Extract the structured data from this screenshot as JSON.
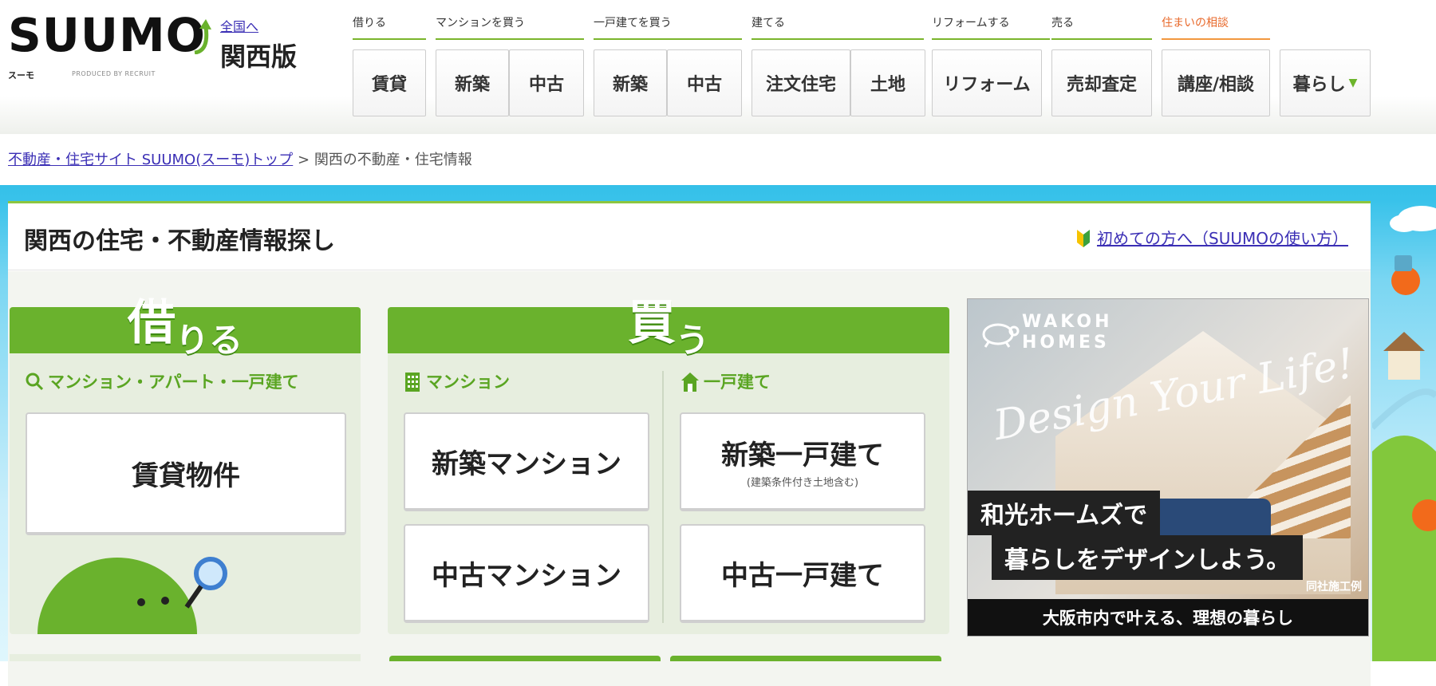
{
  "header": {
    "logo_text": "SUUMO",
    "logo_sub": "スーモ",
    "logo_produced": "PRODUCED BY RECRUIT",
    "region_link": "全国へ",
    "region_name": "関西版",
    "categories": [
      "借りる",
      "マンションを買う",
      "一戸建てを買う",
      "建てる",
      "リフォームする",
      "売る",
      "住まいの相談"
    ],
    "nav": [
      "賃貸",
      "新築",
      "中古",
      "新築",
      "中古",
      "注文住宅",
      "土地",
      "リフォーム",
      "売却査定",
      "講座/相談",
      "暮らし"
    ],
    "nav_dropdown_mark": "▼"
  },
  "breadcrumb": {
    "home": "不動産・住宅サイト SUUMO(スーモ)トップ",
    "sep": ">",
    "current": "関西の不動産・住宅情報"
  },
  "main": {
    "title": "関西の住宅・不動産情報探し",
    "guide_link": "初めての方へ（SUUMOの使い方）",
    "rent": {
      "head_big": "借",
      "head_small": "りる",
      "sub": "マンション・アパート・一戸建て",
      "card": "賃貸物件"
    },
    "buy": {
      "head_big": "買",
      "head_small": "う",
      "mansion_label": "マンション",
      "house_label": "一戸建て",
      "new_mansion": "新築マンション",
      "used_mansion": "中古マンション",
      "new_house": "新築一戸建て",
      "new_house_note": "(建築条件付き土地含む)",
      "used_house": "中古一戸建て"
    }
  },
  "ad": {
    "brand_line1": "WAKOH",
    "brand_line2": "HOMES",
    "script": "Design Your Life!",
    "line1": "和光ホームズで",
    "line2": "暮らしをデザインしよう。",
    "credit": "同社施工例",
    "footer": "大阪市内で叶える、理想の暮らし"
  },
  "colors": {
    "green": "#6ab22d",
    "orange": "#e8692b",
    "sky": "#35c0e8",
    "link": "#3b2fb5"
  }
}
